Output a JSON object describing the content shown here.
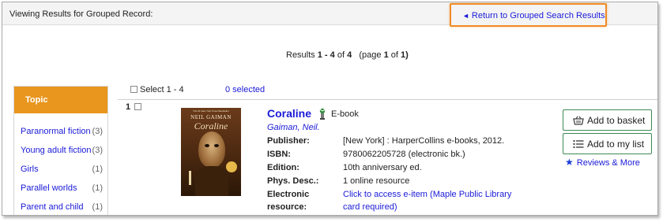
{
  "header": {
    "viewing_text": "Viewing Results for Grouped Record:",
    "return_link": "Return to Grouped Search Results",
    "return_icon": "left-triangle-icon",
    "highlight_color": "#f08a24"
  },
  "results": {
    "prefix": "Results",
    "range": "1 - 4",
    "of_word": "of",
    "total": "4",
    "page_open": "(page",
    "page": "1",
    "page_of": "of",
    "pages": "1)"
  },
  "facet": {
    "heading": "Topic",
    "heading_color": "#e8961e",
    "items": [
      {
        "label": "Paranormal fiction",
        "count": "(3)"
      },
      {
        "label": "Young adult fiction",
        "count": "(3)"
      },
      {
        "label": "Girls",
        "count": "(1)"
      },
      {
        "label": "Parallel worlds",
        "count": "(1)"
      },
      {
        "label": "Parent and child",
        "count": "(1)"
      }
    ]
  },
  "selection": {
    "select_label": "Select 1 - 4",
    "selected_count": "0 selected"
  },
  "record": {
    "number": "1",
    "title": "Coraline",
    "format": "E-book",
    "format_icon": "ebook-icon",
    "author": "Gaiman, Neil.",
    "cover": {
      "blurb": "The #1 New York Times Bestseller",
      "author": "NEIL GAIMAN",
      "title": "Coraline"
    },
    "fields": [
      {
        "label": "Publisher:",
        "value": "[New York] : HarperCollins e-books, 2012."
      },
      {
        "label": "ISBN:",
        "value": "9780062205728 (electronic bk.)"
      },
      {
        "label": "Edition:",
        "value": "10th anniversary ed."
      },
      {
        "label": "Phys. Desc.:",
        "value": "1 online resource"
      }
    ],
    "electronic": {
      "label_line1": "Electronic",
      "label_line2": "resource:",
      "link_line1": "Click to access e-item (Maple Public Library",
      "link_line2": "card required)"
    }
  },
  "actions": {
    "basket": "Add to basket",
    "basket_icon": "basket-icon",
    "list": "Add to my list",
    "list_icon": "list-icon",
    "reviews": "Reviews & More",
    "reviews_icon": "star-icon",
    "button_border_color": "#3e8a55"
  }
}
